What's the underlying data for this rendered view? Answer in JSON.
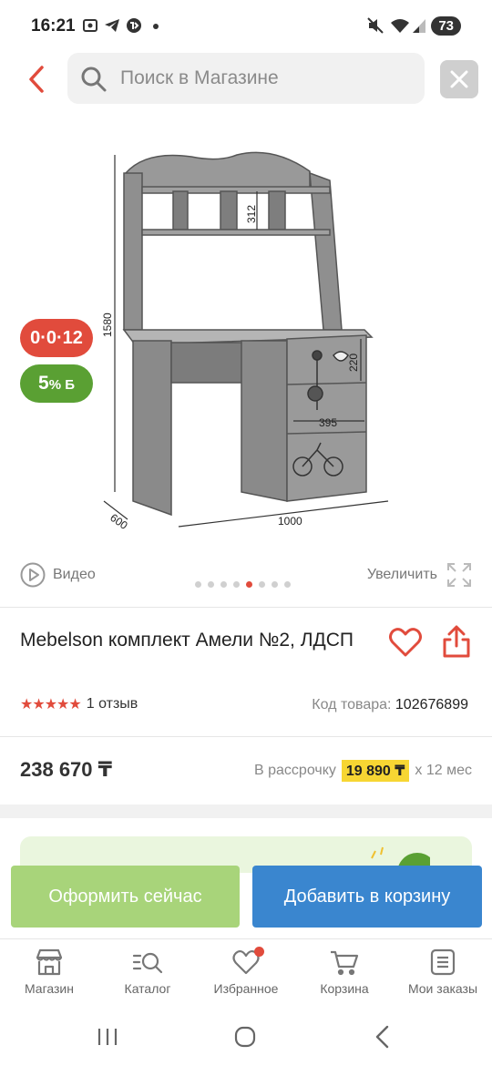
{
  "status_bar": {
    "time": "16:21",
    "battery": "73"
  },
  "search": {
    "placeholder": "Поиск в Магазине"
  },
  "product_image": {
    "dim_height": "1580",
    "dim_shelf": "312",
    "dim_drawer_h": "220",
    "dim_drawer_w": "395",
    "dim_depth": "600",
    "dim_width": "1000"
  },
  "badges": {
    "installment": "0·0·12",
    "bonus_value": "5",
    "bonus_suffix": "% Б"
  },
  "gallery": {
    "video_label": "Видео",
    "zoom_label": "Увеличить",
    "dot_count": 8,
    "active_dot": 4
  },
  "product": {
    "title": "Mebelson комплект Амели №2, ЛДСП",
    "stars": "★★★★★",
    "reviews": "1 отзыв",
    "code_label": "Код товара:",
    "code_value": "102676899",
    "price": "238 670 ₸",
    "installment_label": "В рассрочку",
    "installment_amount": "19 890 ₸",
    "installment_term": "х 12 мес"
  },
  "actions": {
    "buy_now": "Оформить сейчас",
    "add_to_cart": "Добавить в корзину"
  },
  "tabs": [
    {
      "label": "Магазин",
      "icon": "shop-icon"
    },
    {
      "label": "Каталог",
      "icon": "catalog-icon"
    },
    {
      "label": "Избранное",
      "icon": "heart-icon"
    },
    {
      "label": "Корзина",
      "icon": "cart-icon"
    },
    {
      "label": "Мои заказы",
      "icon": "orders-icon"
    }
  ],
  "colors": {
    "accent_red": "#e14b3c",
    "green": "#5aa033",
    "button_green": "#a8d47a",
    "button_blue": "#3a86cf",
    "highlight_yellow": "#f7d633"
  }
}
